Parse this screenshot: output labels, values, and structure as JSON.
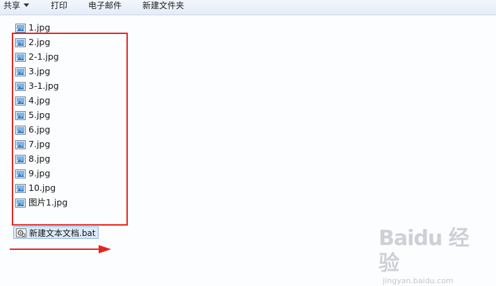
{
  "toolbar": {
    "share_label": "共享",
    "print_label": "打印",
    "email_label": "电子邮件",
    "new_folder_label": "新建文件夹"
  },
  "files": [
    {
      "name": "1.jpg",
      "icon": "image-file-icon"
    },
    {
      "name": "2.jpg",
      "icon": "image-file-icon"
    },
    {
      "name": "2-1.jpg",
      "icon": "image-file-icon"
    },
    {
      "name": "3.jpg",
      "icon": "image-file-icon"
    },
    {
      "name": "3-1.jpg",
      "icon": "image-file-icon"
    },
    {
      "name": "4.jpg",
      "icon": "image-file-icon"
    },
    {
      "name": "5.jpg",
      "icon": "image-file-icon"
    },
    {
      "name": "6.jpg",
      "icon": "image-file-icon"
    },
    {
      "name": "7.jpg",
      "icon": "image-file-icon"
    },
    {
      "name": "8.jpg",
      "icon": "image-file-icon"
    },
    {
      "name": "9.jpg",
      "icon": "image-file-icon"
    },
    {
      "name": "10.jpg",
      "icon": "image-file-icon"
    },
    {
      "name": "图片1.jpg",
      "icon": "image-file-icon"
    }
  ],
  "selected_file": {
    "name": "新建文本文档.bat",
    "icon": "batch-file-icon"
  },
  "annotation": {
    "box_color": "#e8231f",
    "arrow_color": "#e8231f"
  },
  "watermark": {
    "logo": "Baidu 经验",
    "url": "jingyan.baidu.com"
  }
}
